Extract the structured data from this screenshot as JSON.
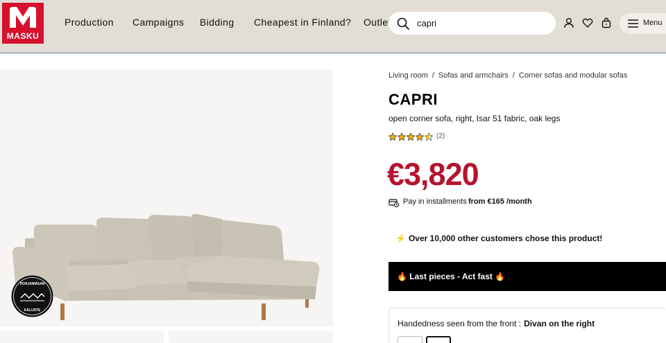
{
  "header": {
    "logo_text": "MASKU",
    "nav": [
      {
        "label": "Production"
      },
      {
        "label": "Campaigns"
      },
      {
        "label": "Bidding"
      },
      {
        "label": "Cheapest in Finland?"
      },
      {
        "label": "Outlet"
      }
    ],
    "search": {
      "value": "capri",
      "icon": "search-icon"
    },
    "icons": [
      "user-icon",
      "heart-icon",
      "shopping-bag-icon"
    ],
    "menu_label": "Menu"
  },
  "gallery": {
    "brand_seal_text": [
      "POHJANMAAN",
      "KALUSTE"
    ]
  },
  "product": {
    "breadcrumb": [
      "Living room",
      "Sofas and armchairs",
      "Corner sofas and modular sofas"
    ],
    "title": "CAPRI",
    "subtitle": "open corner sofa, right, Isar 51 fabric, oak legs",
    "rating": {
      "stars": 4.5,
      "max": 5,
      "count_label": "(2)"
    },
    "price": "€3,820",
    "installments": {
      "label": "Pay in installments",
      "amount": "from €165 /month"
    },
    "customers_note": "Over 10,000 other customers chose this product!",
    "last_pieces": "Last pieces - Act fast",
    "handedness": {
      "label": "Handedness seen from the front :",
      "value": "Divan on the right"
    }
  },
  "colors": {
    "brand_red": "#d6102d",
    "price_red": "#b5142e",
    "header_bg": "#e2ddd5",
    "banner_bg": "#000000"
  }
}
